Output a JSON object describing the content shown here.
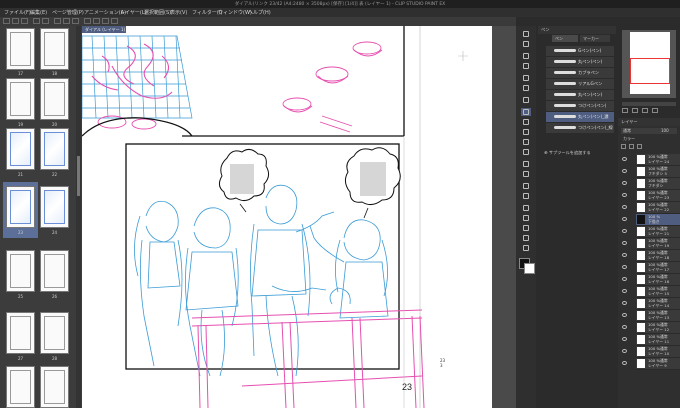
{
  "window": {
    "title": "ダイアル(リンク 23/42 (A4:2480 × 3508px) [保存] [1/4]] 表 (レイヤー 1) - CLIP STUDIO PAINT EX"
  },
  "menu": [
    "ファイル(F)",
    "編集(E)",
    "ページ管理(P)",
    "アニメーション(A)",
    "レイヤー(L)",
    "選択範囲(S)",
    "表示(V)",
    "フィルター(I)",
    "ウィンドウ(W)",
    "ヘルプ(H)"
  ],
  "page_panel": {
    "pages": [
      {
        "label": "17",
        "style": "plain"
      },
      {
        "label": "18",
        "style": "plain"
      },
      {
        "label": "19",
        "style": "plain"
      },
      {
        "label": "20",
        "style": "plain"
      },
      {
        "label": "21",
        "style": "sketch"
      },
      {
        "label": "22",
        "style": "sketch"
      },
      {
        "label": "23",
        "style": "sketch",
        "selected": true
      },
      {
        "label": "24",
        "style": "sketch"
      },
      {
        "label": "25",
        "style": "plain"
      },
      {
        "label": "26",
        "style": "plain"
      },
      {
        "label": "27",
        "style": "plain"
      },
      {
        "label": "28",
        "style": "plain"
      },
      {
        "label": "29",
        "style": "plain"
      },
      {
        "label": "30",
        "style": "plain"
      }
    ]
  },
  "canvas": {
    "tab_label": "ダイアル (レイヤー 1)",
    "page_number": "23",
    "side_number_top": "23",
    "side_number_bottom": "3"
  },
  "sub_tool": {
    "header": "ペン",
    "tabs": [
      "ペン",
      "マーカー"
    ],
    "brushes": [
      {
        "label": "Gペン(ペン)",
        "active": false
      },
      {
        "label": "丸ペン(ペン)",
        "active": false
      },
      {
        "label": "カブラペン",
        "active": false
      },
      {
        "label": "リアルGペン",
        "active": false
      },
      {
        "label": "丸ペン(ペン)",
        "active": false
      },
      {
        "label": "つけペン(ペン)",
        "active": false
      },
      {
        "label": "丸ペン(ペン)_濃",
        "active": true
      },
      {
        "label": "つけペン(ペン)_線",
        "active": false
      }
    ],
    "add_button": "サブツールを追加する"
  },
  "layers_panel": {
    "title": "レイヤー",
    "blend_mode": "通常",
    "opacity": "100",
    "color_label": "カラー",
    "rows": [
      {
        "name": "100 %通常",
        "sub": "レイヤー 24"
      },
      {
        "name": "100 %通常",
        "sub": "フキダシ 5"
      },
      {
        "name": "100 %通常",
        "sub": "フキダシ"
      },
      {
        "name": "100 %通常",
        "sub": "レイヤー 23"
      },
      {
        "name": "100 %通常",
        "sub": "レイヤー 22"
      },
      {
        "name": "100 %",
        "sub": "下描き",
        "selected": true
      },
      {
        "name": "100 %通常",
        "sub": "レイヤー 21"
      },
      {
        "name": "100 %通常",
        "sub": "レイヤー 19"
      },
      {
        "name": "100 %通常",
        "sub": "レイヤー 18"
      },
      {
        "name": "100 %通常",
        "sub": "レイヤー 17"
      },
      {
        "name": "100 %通常",
        "sub": "レイヤー 16"
      },
      {
        "name": "100 %通常",
        "sub": "レイヤー 15"
      },
      {
        "name": "100 %通常",
        "sub": "レイヤー 14"
      },
      {
        "name": "100 %通常",
        "sub": "レイヤー 13"
      },
      {
        "name": "100 %通常",
        "sub": "レイヤー 12"
      },
      {
        "name": "100 %通常",
        "sub": "レイヤー 11"
      },
      {
        "name": "100 %通常",
        "sub": "レイヤー 10"
      },
      {
        "name": "100 %通常",
        "sub": "レイヤー 9"
      }
    ]
  },
  "colors": {
    "sketch_blue": "#3a9bd5",
    "sketch_pink": "#e64fb0",
    "panel_dark": "#2b2b2b",
    "accent": "#4f5d80"
  }
}
